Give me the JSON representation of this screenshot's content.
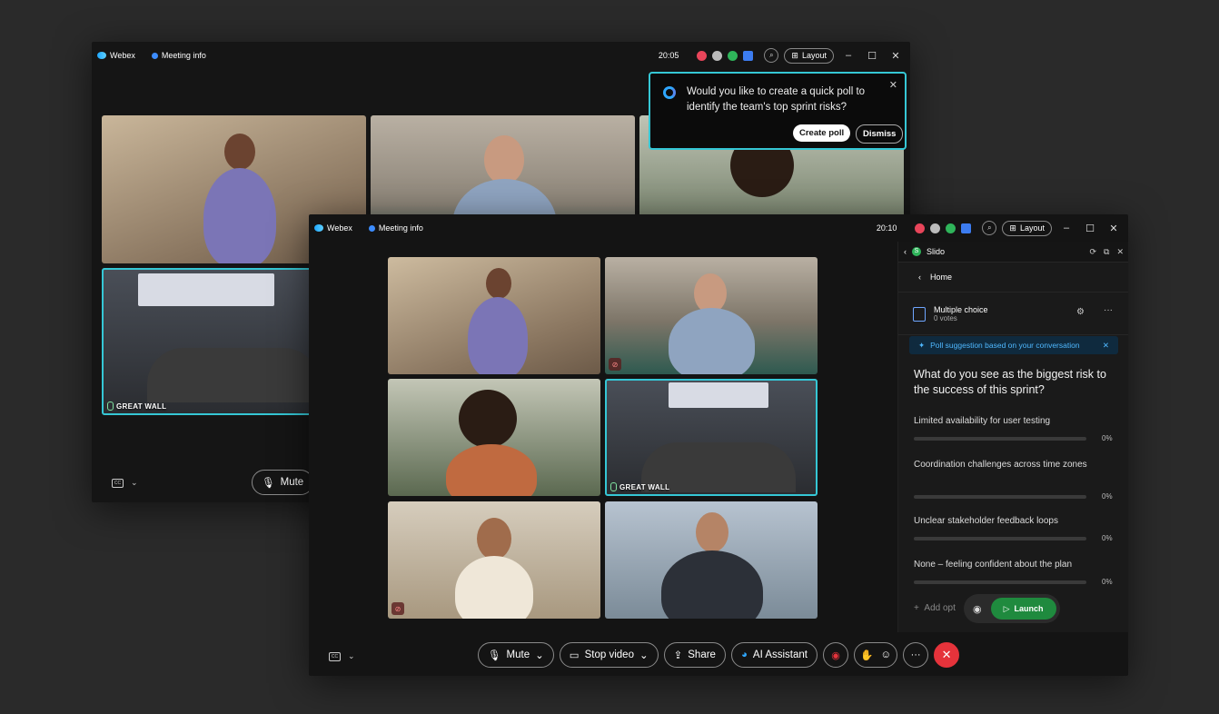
{
  "back_window": {
    "app_name": "Webex",
    "meeting_info": "Meeting info",
    "clock": "20:05",
    "layout_label": "Layout",
    "mute_label": "Mute",
    "room_label": "GREAT WALL"
  },
  "poll_popup": {
    "question": "Would you like to create a quick poll to identify the team's top sprint risks?",
    "create_label": "Create poll",
    "dismiss_label": "Dismiss"
  },
  "front_window": {
    "app_name": "Webex",
    "meeting_info": "Meeting info",
    "clock": "20:10",
    "layout_label": "Layout",
    "room_label": "GREAT WALL",
    "controls": {
      "mute": "Mute",
      "stop_video": "Stop video",
      "share": "Share",
      "ai_assistant": "AI Assistant"
    }
  },
  "slido": {
    "title": "Slido",
    "home_label": "Home",
    "question_type": "Multiple choice",
    "votes": "0 votes",
    "suggestion": "Poll suggestion based on your conversation",
    "question": "What do you see as the biggest risk to the success of this sprint?",
    "options": [
      {
        "label": "Limited availability for user testing",
        "percent": "0%"
      },
      {
        "label": "Coordination challenges across time zones",
        "percent": "0%"
      },
      {
        "label": "Unclear stakeholder feedback loops",
        "percent": "0%"
      },
      {
        "label": "None – feeling confident about the plan",
        "percent": "0%"
      }
    ],
    "add_option": "Add opt",
    "launch_label": "Launch"
  },
  "colors": {
    "accent": "#35c7d5",
    "slido_green": "#2fb45a",
    "end_call": "#e5333b"
  }
}
